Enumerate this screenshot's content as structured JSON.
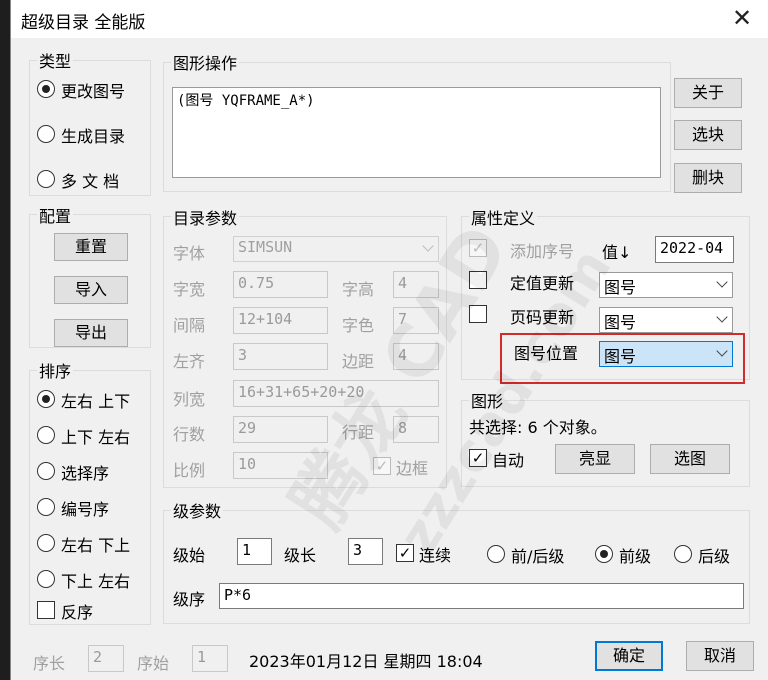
{
  "window": {
    "title": "超级目录 全能版"
  },
  "type_group": {
    "label": "类型",
    "options": [
      {
        "label": "更改图号",
        "selected": true
      },
      {
        "label": "生成目录",
        "selected": false
      },
      {
        "label": "多 文 档",
        "selected": false
      }
    ]
  },
  "config_group": {
    "label": "配置",
    "reset": "重置",
    "import": "导入",
    "export": "导出"
  },
  "sort_group": {
    "label": "排序",
    "options": [
      {
        "label": "左右 上下",
        "selected": true
      },
      {
        "label": "上下 左右",
        "selected": false
      },
      {
        "label": "选择序",
        "selected": false
      },
      {
        "label": "编号序",
        "selected": false
      },
      {
        "label": "左右 下上",
        "selected": false
      },
      {
        "label": "下上 左右",
        "selected": false
      }
    ],
    "reverse": {
      "label": "反序",
      "checked": false
    }
  },
  "shape_ops": {
    "label": "图形操作",
    "text": "(图号 YQFRAME_A*)",
    "about": "关于",
    "select_block": "选块",
    "delete_block": "删块"
  },
  "catalog_params": {
    "label": "目录参数",
    "font_label": "字体",
    "font_value": "SIMSUN",
    "char_width_label": "字宽",
    "char_width": "0.75",
    "char_height_label": "字高",
    "char_height": "4",
    "spacing_label": "间隔",
    "spacing": "12+104",
    "char_color_label": "字色",
    "char_color": "7",
    "left_align_label": "左齐",
    "left_align": "3",
    "margin_label": "边距",
    "margin": "4",
    "col_width_label": "列宽",
    "col_width": "16+31+65+20+20",
    "rows_label": "行数",
    "rows": "29",
    "row_spacing_label": "行距",
    "row_spacing": "8",
    "scale_label": "比例",
    "scale": "10",
    "border": {
      "label": "边框",
      "checked": true
    }
  },
  "attr_def": {
    "label": "属性定义",
    "add_seq": {
      "label": "添加序号",
      "checked": true
    },
    "value_label": "值↓",
    "value": "2022-04",
    "fixed_update": {
      "label": "定值更新",
      "checked": false,
      "select": "图号"
    },
    "page_update": {
      "label": "页码更新",
      "checked": false,
      "select": "图号"
    },
    "number_position": {
      "label": "图号位置",
      "select": "图号"
    }
  },
  "graphic": {
    "label": "图形",
    "status": "共选择: 6 个对象。",
    "auto": {
      "label": "自动",
      "checked": true
    },
    "highlight": "亮显",
    "select_shape": "选图"
  },
  "level_params": {
    "label": "级参数",
    "start_label": "级始",
    "start": "1",
    "length_label": "级长",
    "length": "3",
    "continuous": {
      "label": "连续",
      "checked": true
    },
    "prefix_suffix": {
      "label": "前/后级",
      "selected": false
    },
    "prefix": {
      "label": "前级",
      "selected": true
    },
    "suffix": {
      "label": "后级",
      "selected": false
    },
    "order_label": "级序",
    "order": "P*6"
  },
  "footer": {
    "seq_len_label": "序长",
    "seq_len": "2",
    "seq_start_label": "序始",
    "seq_start": "1",
    "datetime": "2023年01月12日 星期四 18:04",
    "ok": "确定",
    "cancel": "取消"
  },
  "watermark": {
    "text_cn": "腾龙 CAD",
    "text_url": "zzzcad.com"
  },
  "colors": {
    "highlight_box": "#d12b2b",
    "focus_blue": "#0078d7",
    "selected_bg": "#cce4f7"
  }
}
